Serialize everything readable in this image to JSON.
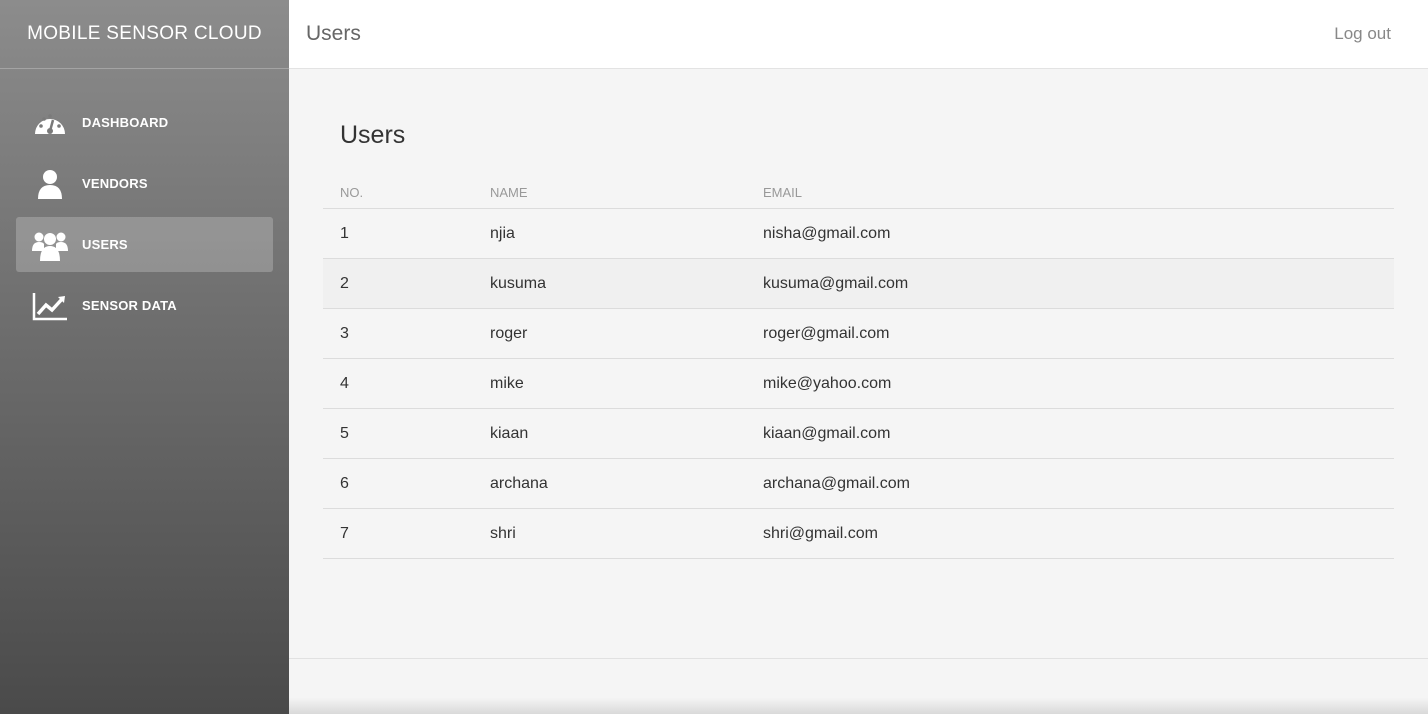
{
  "app": {
    "title": "MOBILE SENSOR CLOUD"
  },
  "sidebar": {
    "items": [
      {
        "label": "DASHBOARD",
        "icon": "dashboard-icon",
        "active": false
      },
      {
        "label": "VENDORS",
        "icon": "person-icon",
        "active": false
      },
      {
        "label": "USERS",
        "icon": "users-icon",
        "active": true
      },
      {
        "label": "SENSOR DATA",
        "icon": "line-chart-icon",
        "active": false
      }
    ]
  },
  "header": {
    "title": "Users",
    "logout_label": "Log out"
  },
  "main": {
    "title": "Users",
    "table": {
      "columns": [
        "NO.",
        "NAME",
        "EMAIL"
      ],
      "rows": [
        {
          "no": "1",
          "name": "njia",
          "email": "nisha@gmail.com"
        },
        {
          "no": "2",
          "name": "kusuma",
          "email": "kusuma@gmail.com"
        },
        {
          "no": "3",
          "name": "roger",
          "email": "roger@gmail.com"
        },
        {
          "no": "4",
          "name": "mike",
          "email": "mike@yahoo.com"
        },
        {
          "no": "5",
          "name": "kiaan",
          "email": "kiaan@gmail.com"
        },
        {
          "no": "6",
          "name": "archana",
          "email": "archana@gmail.com"
        },
        {
          "no": "7",
          "name": "shri",
          "email": "shri@gmail.com"
        }
      ]
    }
  },
  "colors": {
    "sidebar_top": "#8c8c8c",
    "sidebar_bottom": "#4a4a4a",
    "active_item": "#a6a6a6",
    "text": "#333333"
  }
}
